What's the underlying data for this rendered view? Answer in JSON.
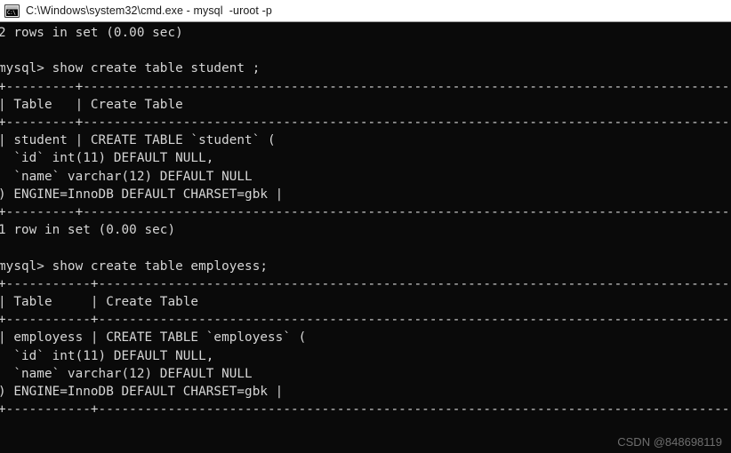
{
  "window": {
    "titlebar": {
      "icon": "cmd-console-icon",
      "icon_text": "C:\\",
      "title": "C:\\Windows\\system32\\cmd.exe - mysql  -uroot -p"
    },
    "background_color": "#0a0a0a",
    "foreground_color": "#d6d6d6",
    "titlebar_color": "#ffffff"
  },
  "console": {
    "prompt": "mysql>",
    "commands": [
      "show create table student ;",
      "show create table employess;"
    ],
    "status_lines": [
      "2 rows in set (0.00 sec)",
      "1 row in set (0.00 sec)"
    ],
    "result_blocks": [
      {
        "table_name": "student",
        "columns": [
          "Table",
          "Create Table"
        ],
        "create_statement_lines": [
          "CREATE TABLE `student` (",
          "  `id` int(11) DEFAULT NULL,",
          "  `name` varchar(12) DEFAULT NULL",
          ") ENGINE=InnoDB DEFAULT CHARSET=gbk"
        ],
        "engine": "InnoDB",
        "charset": "gbk"
      },
      {
        "table_name": "employess",
        "columns": [
          "Table",
          "Create Table"
        ],
        "create_statement_lines": [
          "CREATE TABLE `employess` (",
          "  `id` int(11) DEFAULT NULL,",
          "  `name` varchar(12) DEFAULT NULL",
          ") ENGINE=InnoDB DEFAULT CHARSET=gbk"
        ],
        "engine": "InnoDB",
        "charset": "gbk"
      }
    ],
    "buffer": "2 rows in set (0.00 sec)\n\nmysql> show create table student ;\n+---------+-----------------------------------------------------------------------------------------------------------+\n| Table   | Create Table                                                                                              |\n+---------+-----------------------------------------------------------------------------------------------------------+\n| student | CREATE TABLE `student` (\n  `id` int(11) DEFAULT NULL,\n  `name` varchar(12) DEFAULT NULL\n) ENGINE=InnoDB DEFAULT CHARSET=gbk |\n+---------+-----------------------------------------------------------------------------------------------------------+\n1 row in set (0.00 sec)\n\nmysql> show create table employess;\n+-----------+-------------------------------------------------------------------------------------------------------+\n| Table     | Create Table                                                                                          |\n+-----------+-------------------------------------------------------------------------------------------------------+\n| employess | CREATE TABLE `employess` (\n  `id` int(11) DEFAULT NULL,\n  `name` varchar(12) DEFAULT NULL\n) ENGINE=InnoDB DEFAULT CHARSET=gbk |\n+-----------+-------------------------------------------------------------------------------------------------------+"
  },
  "watermark": {
    "text": "CSDN @848698119"
  }
}
